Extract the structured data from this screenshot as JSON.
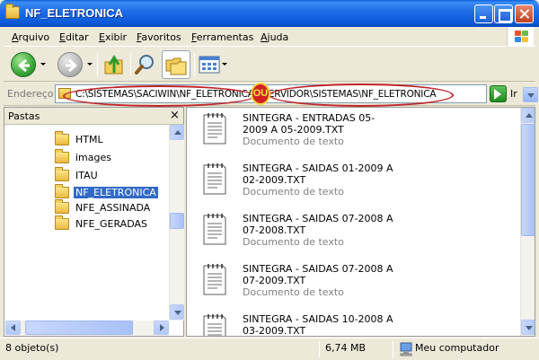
{
  "window": {
    "title": "NF_ELETRONICA",
    "buttons": {
      "minimize": "minimize",
      "maximize": "maximize",
      "close": "close"
    }
  },
  "menu": {
    "items": [
      {
        "label": "Arquivo"
      },
      {
        "label": "Editar"
      },
      {
        "label": "Exibir"
      },
      {
        "label": "Favoritos"
      },
      {
        "label": "Ferramentas"
      },
      {
        "label": "Ajuda"
      }
    ]
  },
  "toolbar": {
    "icons": [
      "back-icon",
      "forward-icon",
      "up-folder-icon",
      "search-icon",
      "folders-icon",
      "views-icon"
    ]
  },
  "address": {
    "label": "Endereço",
    "value": "C:\\SISTEMAS\\SACIWIN\\NF_ELETRONICA      \\\\SERVIDOR\\SISTEMAS\\NF_ELETRONICA",
    "go_label": "Ir"
  },
  "annotation": {
    "ou": "OU",
    "color": "#c0262a"
  },
  "folders_pane": {
    "title": "Pastas",
    "close": "×",
    "items": [
      {
        "label": "HTML",
        "selected": false
      },
      {
        "label": "images",
        "selected": false
      },
      {
        "label": "ITAU",
        "selected": false
      },
      {
        "label": "NF_ELETRONICA",
        "selected": true
      },
      {
        "label": "NFE_ASSINADA",
        "selected": false
      },
      {
        "label": "NFE_GERADAS",
        "selected": false
      }
    ]
  },
  "files": [
    {
      "name": "SINTEGRA - ENTRADAS 05-2009 A 05-2009.TXT",
      "type": "Documento de texto"
    },
    {
      "name": "SINTEGRA - SAIDAS 01-2009 A 02-2009.TXT",
      "type": "Documento de texto"
    },
    {
      "name": "SINTEGRA - SAIDAS 07-2008 A 07-2008.TXT",
      "type": "Documento de texto"
    },
    {
      "name": "SINTEGRA - SAIDAS 07-2008 A 07-2009.TXT",
      "type": "Documento de texto"
    },
    {
      "name": "SINTEGRA - SAIDAS 10-2008 A 03-2009.TXT",
      "type": ""
    }
  ],
  "status": {
    "objects": "8 objeto(s)",
    "size": "6,74 MB",
    "location": "Meu computador"
  },
  "colors": {
    "titlebar": "#1f6fe9",
    "selection": "#316ac5",
    "window_bg": "#ece9d8"
  }
}
